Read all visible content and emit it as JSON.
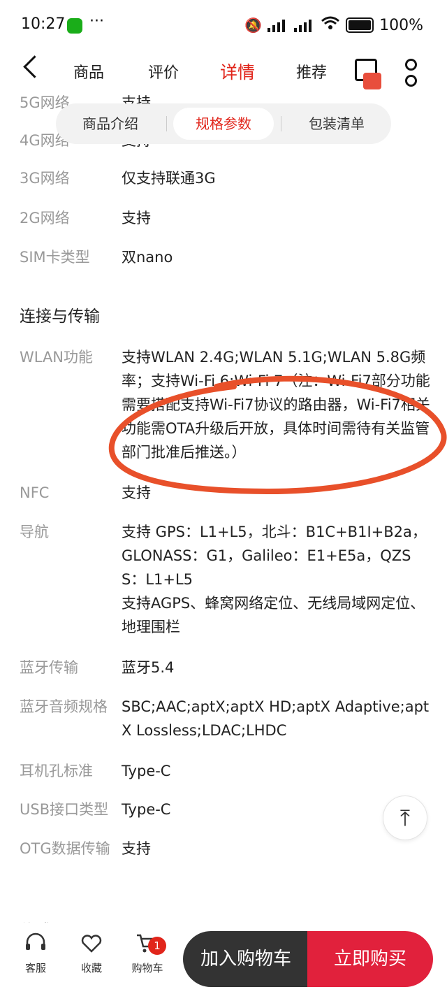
{
  "status_bar": {
    "time": "10:27",
    "dots": "···",
    "battery": "100%"
  },
  "nav": {
    "tabs": [
      "商品",
      "评价",
      "详情",
      "推荐"
    ],
    "active_tab": "详情"
  },
  "segments": {
    "items": [
      "商品介绍",
      "规格参数",
      "包装清单"
    ],
    "active": "规格参数"
  },
  "specs_top": [
    {
      "k": "5G网络",
      "v": "支持"
    },
    {
      "k": "4G网络",
      "v": "支持"
    },
    {
      "k": "3G网络",
      "v": "仅支持联通3G"
    },
    {
      "k": "2G网络",
      "v": "支持"
    },
    {
      "k": "SIM卡类型",
      "v": "双nano"
    }
  ],
  "section_title": "连接与传输",
  "specs": [
    {
      "k": "WLAN功能",
      "v": "支持WLAN 2.4G;WLAN 5.1G;WLAN 5.8G频率；支持Wi-Fi 6;Wi-Fi 7（注：Wi-Fi7部分功能需要搭配支持Wi-Fi7协议的路由器，Wi-Fi7相关功能需OTA升级后开放，具体时间需待有关监管部门批准后推送。）"
    },
    {
      "k": "NFC",
      "v": "支持"
    },
    {
      "k": "导航",
      "v": "支持 GPS：L1+L5，北斗：B1C+B1I+B2a，GLONASS：G1，Galileo：E1+E5a，QZSS：L1+L5\n支持AGPS、蜂窝网络定位、无线局域网定位、地理围栏"
    },
    {
      "k": "蓝牙传输",
      "v": "蓝牙5.4"
    },
    {
      "k": "蓝牙音频规格",
      "v": "SBC;AAC;aptX;aptX HD;aptX Adaptive;aptX Lossless;LDAC;LHDC"
    },
    {
      "k": "耳机孔标准",
      "v": "Type-C"
    },
    {
      "k": "USB接口类型",
      "v": "Type-C"
    },
    {
      "k": "OTG数据传输",
      "v": "支持"
    }
  ],
  "next_section_title": "传感器",
  "bottom": {
    "service": "客服",
    "favorite": "收藏",
    "cart": "购物车",
    "cart_badge": "1",
    "add_to_cart": "加入购物车",
    "buy_now": "立即购买"
  },
  "colors": {
    "accent": "#e1251b",
    "annotation": "#e8502a"
  }
}
